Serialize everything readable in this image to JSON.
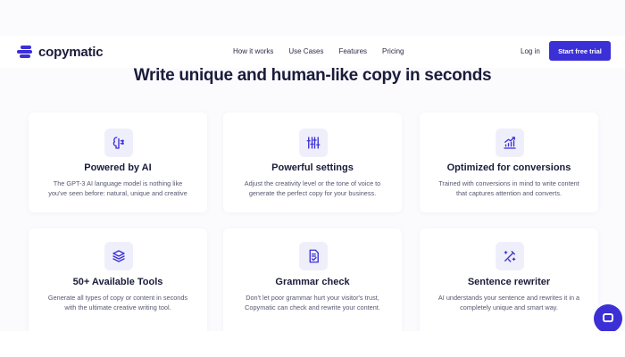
{
  "brand": {
    "name": "copymatic",
    "color": "#3b2fd6"
  },
  "nav": {
    "links": [
      "How it works",
      "Use Cases",
      "Features",
      "Pricing"
    ],
    "login": "Log in",
    "cta": "Start free trial"
  },
  "headline": "Write unique and human-like copy in seconds",
  "features": [
    {
      "icon": "brain-icon",
      "title": "Powered by AI",
      "desc1": "The GPT-3 AI language model is nothing like",
      "desc2": "you've seen before: natural, unique and creative"
    },
    {
      "icon": "sliders-icon",
      "title": "Powerful settings",
      "desc1": "Adjust the creativity level or the tone of voice to",
      "desc2": "generate the perfect copy for your business."
    },
    {
      "icon": "trending-up-icon",
      "title": "Optimized for conversions",
      "desc1": "Trained with conversions in mind to write content",
      "desc2": "that captures attention and converts."
    },
    {
      "icon": "stack-icon",
      "title": "50+ Available Tools",
      "desc1": "Generate all types of copy or content in seconds",
      "desc2": "with the ultimate creative writing tool."
    },
    {
      "icon": "check-document-icon",
      "title": "Grammar check",
      "desc1": "Don't let poor grammar hurt your visitor's trust,",
      "desc2": "Copymatic can check and rewrite your content."
    },
    {
      "icon": "wand-icon",
      "title": "Sentence rewriter",
      "desc1": "AI understands your sentence and rewrites it in a",
      "desc2": "completely unique and smart way."
    }
  ],
  "chat": {
    "icon": "chat-icon"
  }
}
